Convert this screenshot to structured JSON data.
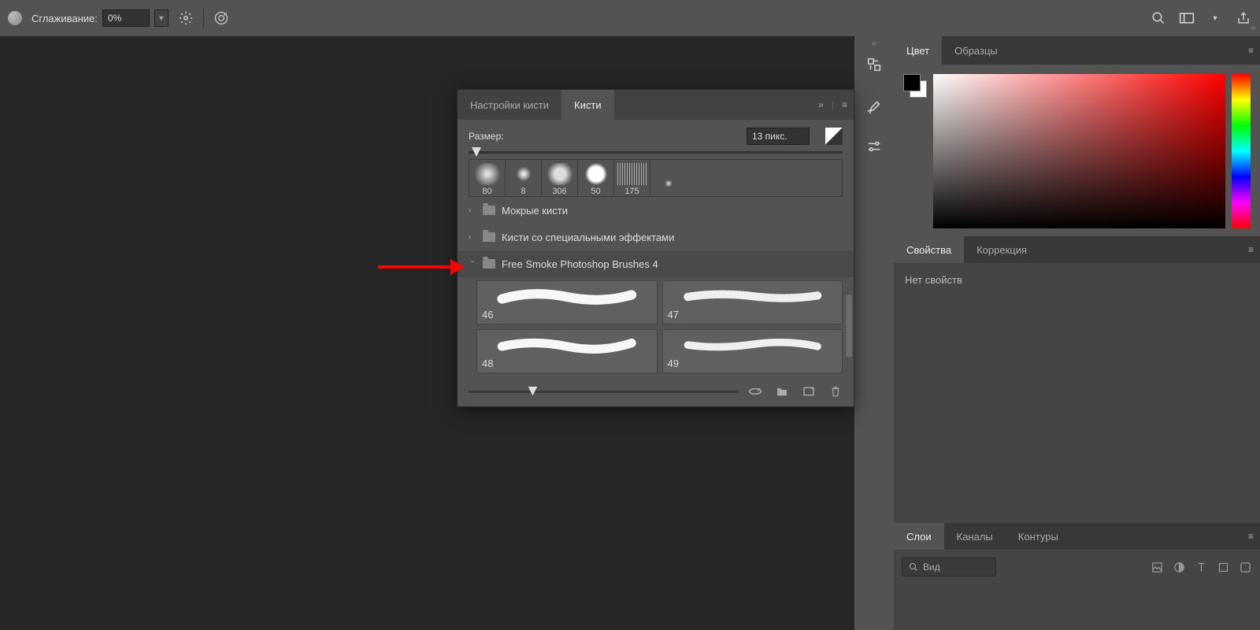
{
  "topbar": {
    "smoothing_label": "Сглаживание:",
    "smoothing_value": "0%"
  },
  "brushes_panel": {
    "tab_settings": "Настройки кисти",
    "tab_brushes": "Кисти",
    "size_label": "Размер:",
    "size_value": "13 пикс.",
    "presets": [
      "80",
      "8",
      "306",
      "50",
      "175"
    ],
    "folders": [
      {
        "name": "Мокрые кисти",
        "open": false
      },
      {
        "name": "Кисти со специальными эффектами",
        "open": false
      },
      {
        "name": "Free Smoke Photoshop Brushes 4",
        "open": true
      }
    ],
    "open_brushes": [
      "46",
      "47",
      "48",
      "49"
    ]
  },
  "color_panel": {
    "tab_color": "Цвет",
    "tab_swatches": "Образцы"
  },
  "props_panel": {
    "tab_properties": "Свойства",
    "tab_adjustments": "Коррекция",
    "no_props": "Нет свойств"
  },
  "layers_panel": {
    "tab_layers": "Слои",
    "tab_channels": "Каналы",
    "tab_paths": "Контуры",
    "kind_label": "Вид"
  }
}
